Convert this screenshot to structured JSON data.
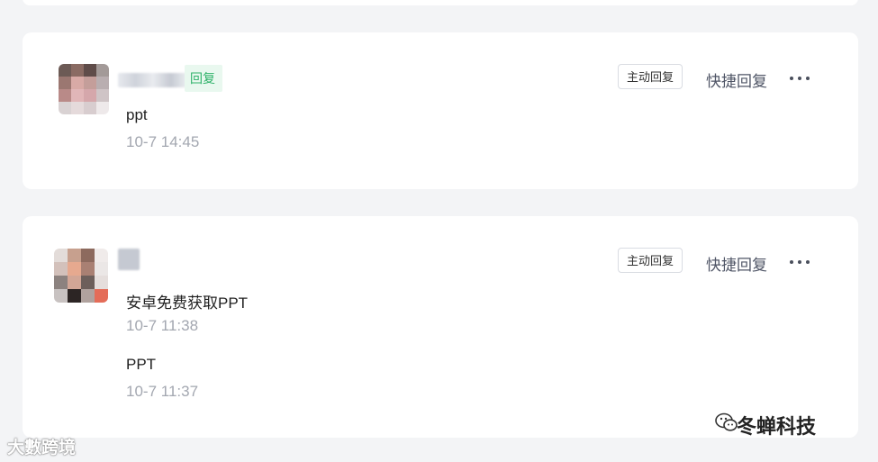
{
  "conversations": [
    {
      "tag": "回复",
      "actions": {
        "active_reply": "主动回复",
        "quick_reply": "快捷回复"
      },
      "messages": [
        {
          "text": "ppt",
          "time": "10-7 14:45"
        }
      ]
    },
    {
      "actions": {
        "active_reply": "主动回复",
        "quick_reply": "快捷回复"
      },
      "messages": [
        {
          "text": "安卓免费获取PPT",
          "time": "10-7 11:38"
        },
        {
          "text": "PPT",
          "time": "10-7 11:37"
        }
      ]
    }
  ],
  "icons": {
    "more": "more-horizontal-icon",
    "wechat": "wechat-icon"
  },
  "watermarks": {
    "left": "大數跨境",
    "right": "冬蝉科技"
  },
  "colors": {
    "background": "#f3f4f6",
    "card": "#ffffff",
    "tag_green": "#2fb26a",
    "time_gray": "#a3a7b0"
  }
}
